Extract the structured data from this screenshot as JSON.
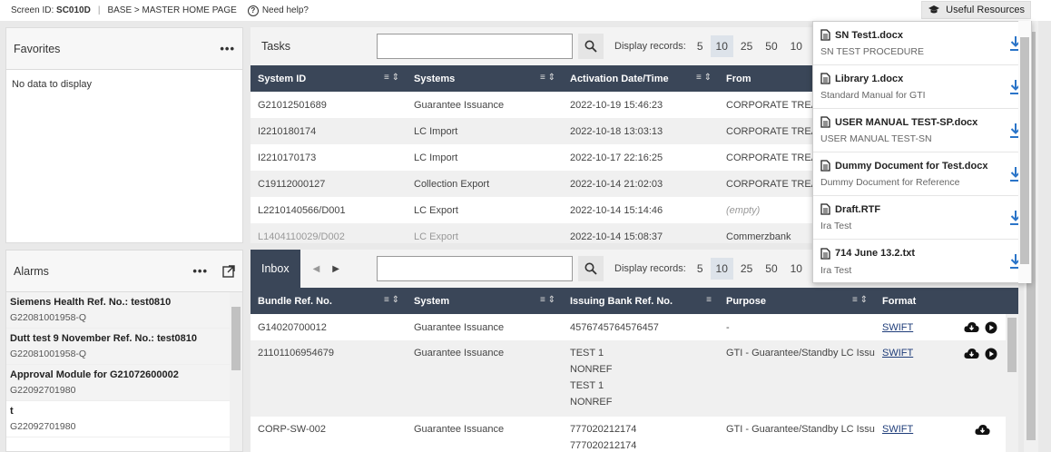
{
  "header": {
    "screen_id_label": "Screen ID:",
    "screen_id": "SC010D",
    "breadcrumb": "BASE > MASTER HOME PAGE",
    "help": "Need help?",
    "useful_resources": "Useful Resources"
  },
  "favorites": {
    "title": "Favorites",
    "empty": "No data to display"
  },
  "alarms": {
    "title": "Alarms",
    "items": [
      {
        "title": "Siemens Health Ref. No.: test0810",
        "sub": "G22081001958-Q"
      },
      {
        "title": "Dutt test 9 November Ref. No.: test0810",
        "sub": "G22081001958-Q"
      },
      {
        "title": "Approval Module for G21072600002",
        "sub": "G22092701980"
      },
      {
        "title": "t",
        "sub": "G22092701980"
      }
    ]
  },
  "display_records": {
    "label": "Display records:",
    "options": [
      "5",
      "10",
      "25",
      "50",
      "10"
    ]
  },
  "tasks": {
    "title": "Tasks",
    "columns": [
      "System ID",
      "Systems",
      "Activation Date/Time",
      "From"
    ],
    "rows": [
      [
        "G21012501689",
        "Guarantee Issuance",
        "2022-10-19 15:46:23",
        "CORPORATE TREASU"
      ],
      [
        "I2210180174",
        "LC Import",
        "2022-10-18 13:03:13",
        "CORPORATE TREASU"
      ],
      [
        "I2210170173",
        "LC Import",
        "2022-10-17 22:16:25",
        "CORPORATE TREASU"
      ],
      [
        "C19112000127",
        "Collection Export",
        "2022-10-14 21:02:03",
        "CORPORATE TREASU"
      ],
      [
        "L2210140566/D001",
        "LC Export",
        "2022-10-14 15:14:46",
        "(empty)"
      ],
      [
        "L1404110029/D002",
        "LC Export",
        "2022-10-14 15:08:37",
        "Commerzbank"
      ]
    ]
  },
  "inbox": {
    "title": "Inbox",
    "columns": [
      "Bundle Ref. No.",
      "System",
      "Issuing Bank Ref. No.",
      "Purpose",
      "Format"
    ],
    "rows": [
      {
        "ref": "G14020700012",
        "system": "Guarantee Issuance",
        "bank": [
          "4576745764576457"
        ],
        "purpose": "-",
        "format": "SWIFT"
      },
      {
        "ref": "21101106954679",
        "system": "Guarantee Issuance",
        "bank": [
          "TEST 1",
          "NONREF",
          "TEST 1",
          "NONREF"
        ],
        "purpose": "GTI - Guarantee/Standby LC Issuanc",
        "format": "SWIFT"
      },
      {
        "ref": "CORP-SW-002",
        "system": "Guarantee Issuance",
        "bank": [
          "777020212174",
          "777020212174"
        ],
        "purpose": "GTI - Guarantee/Standby LC Issuanc",
        "format": "SWIFT"
      }
    ]
  },
  "resources": [
    {
      "name": "SN Test1.docx",
      "desc": "SN TEST PROCEDURE"
    },
    {
      "name": "Library 1.docx",
      "desc": "Standard Manual for GTI"
    },
    {
      "name": "USER MANUAL TEST-SP.docx",
      "desc": "USER MANUAL TEST-SN"
    },
    {
      "name": "Dummy Document for Test.docx",
      "desc": "Dummy Document for Reference"
    },
    {
      "name": "Draft.RTF",
      "desc": "Ira Test"
    },
    {
      "name": "714 June 13.2.txt",
      "desc": "Ira Test"
    }
  ],
  "icons": {
    "search": "search-icon",
    "download": "download-icon",
    "document": "document-icon",
    "sort": "sort-icon",
    "filter": "filter-icon",
    "expand": "expand-icon",
    "cloud_download": "cloud-download-icon",
    "play": "play-icon"
  },
  "colors": {
    "header_dark": "#3a4658",
    "download_blue": "#2a74c8",
    "link": "#1f3d7a"
  }
}
